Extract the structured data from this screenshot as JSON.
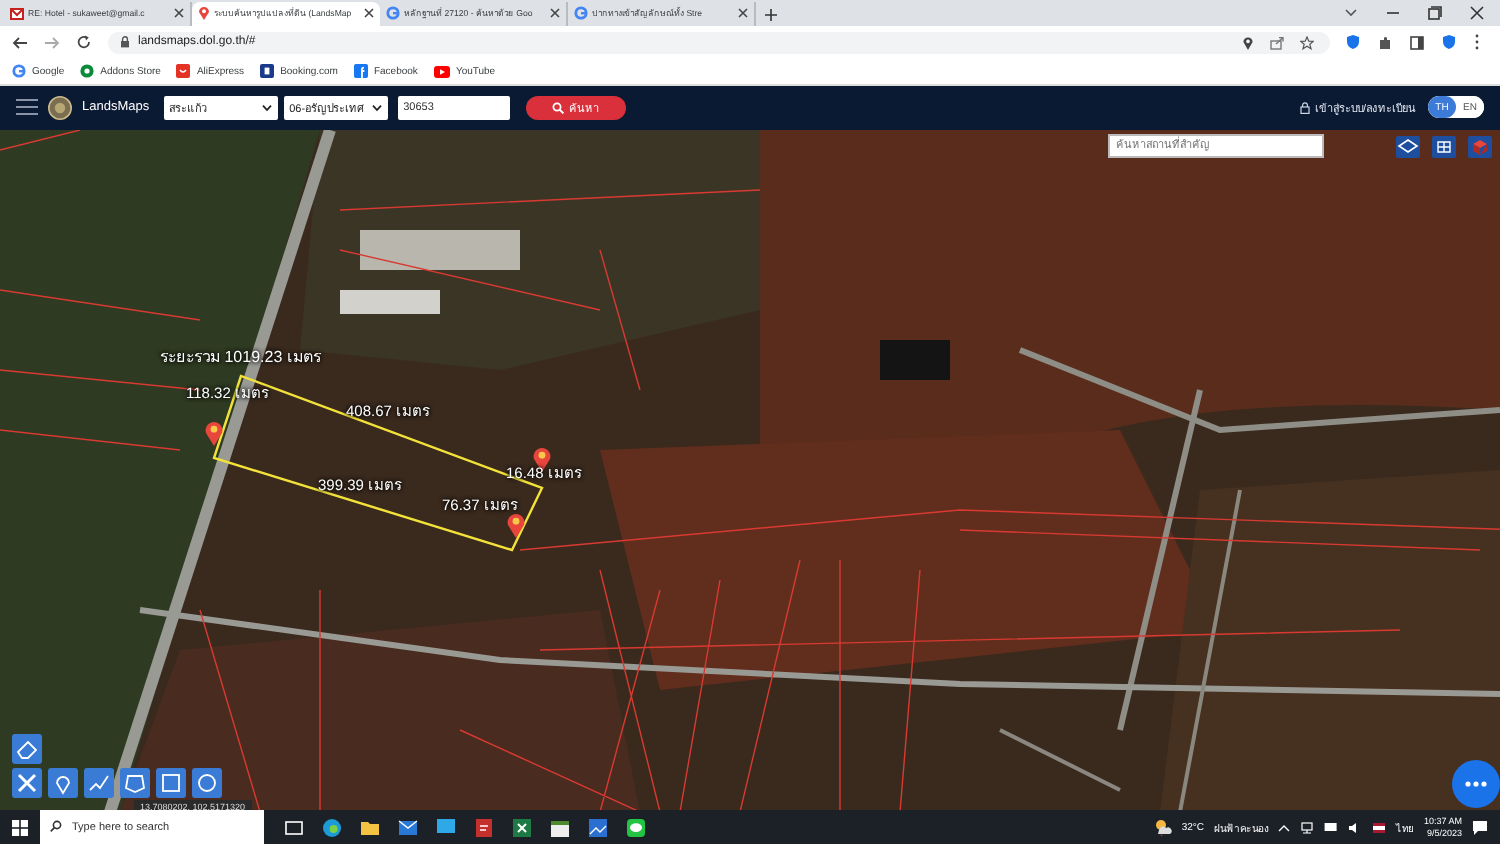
{
  "browser": {
    "tabs": [
      {
        "title": "RE: Hotel - sukaweet@gmail.c",
        "selected": false
      },
      {
        "title": "ระบบค้นหารูปแปลงที่ดิน (LandsMap",
        "selected": true
      },
      {
        "title": "หลักฐานที่ 27120 - ค้นหาด้วย Goo",
        "selected": false
      },
      {
        "title": "ปากทางเข้าสัญลักษณ์ทั้ง Stre",
        "selected": false
      }
    ],
    "address": "landsmaps.dol.go.th/#",
    "bookmarks": [
      {
        "label": "Google"
      },
      {
        "label": "Addons Store"
      },
      {
        "label": "AliExpress"
      },
      {
        "label": "Booking.com"
      },
      {
        "label": "Facebook"
      },
      {
        "label": "YouTube"
      }
    ]
  },
  "app_header": {
    "logo_text": "LandsMaps",
    "province": "สระแก้ว",
    "district": "06-อรัญประเทศ",
    "parcel_number": "30653",
    "search_button": "ค้นหา",
    "login_link": "เข้าสู่ระบบ/ลงทะเบียน",
    "languages": [
      {
        "label": "TH",
        "selected": true
      },
      {
        "label": "EN",
        "selected": false
      }
    ]
  },
  "map": {
    "place_search": {
      "placeholder": "ค้นหาสถานที่สำคัญ"
    },
    "total_distance": "ระยะรวม 1019.23 เมตร",
    "segments": [
      {
        "label": "118.32 เมตร"
      },
      {
        "label": "408.67 เมตร"
      },
      {
        "label": "399.39 เมตร"
      },
      {
        "label": "16.48 เมตร"
      },
      {
        "label": "76.37 เมตร"
      }
    ],
    "coordinates": "13.7080202, 102.5171320"
  },
  "taskbar": {
    "search": {
      "placeholder": "Type here to search"
    },
    "temperature": "32°C",
    "weather": "ฝนฟ้าคะนอง",
    "language": "ไทย",
    "time": "10:37 AM",
    "date": "9/5/2023"
  }
}
